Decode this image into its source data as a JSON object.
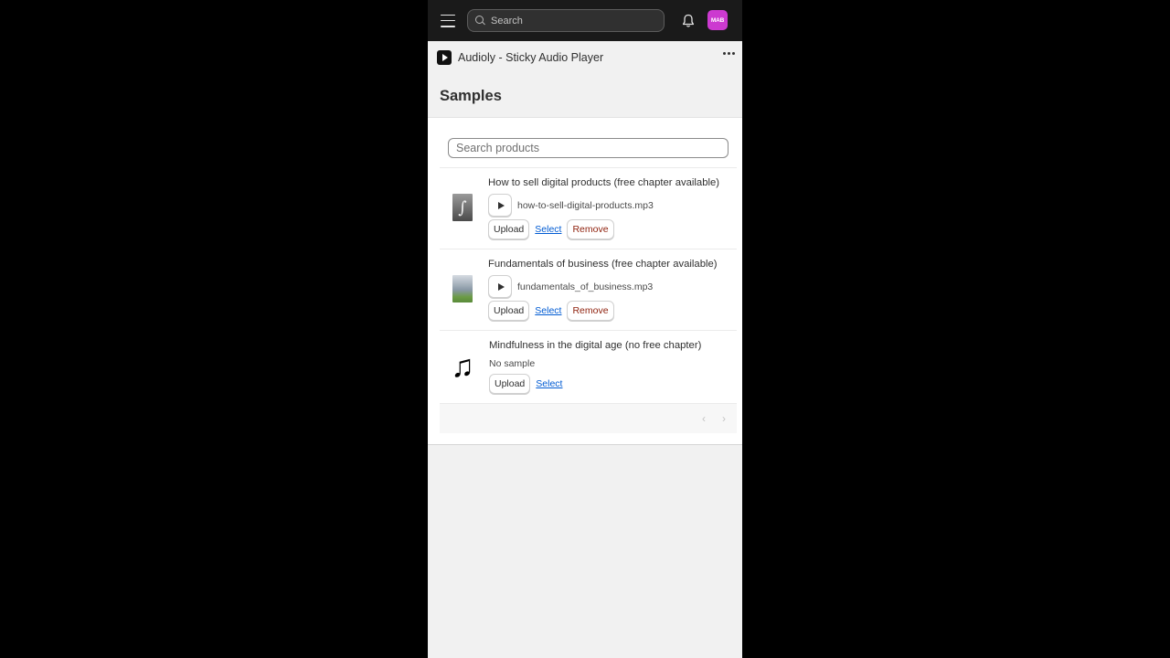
{
  "topbar": {
    "search_placeholder": "Search",
    "avatar_initials": "MAB",
    "colors": {
      "bar": "#1a1a1a",
      "avatar": "#cc3ad0"
    }
  },
  "app": {
    "title": "Audioly - Sticky Audio Player",
    "page_title": "Samples"
  },
  "samples": {
    "search_placeholder": "Search products",
    "products": [
      {
        "title": "How to sell digital products (free chapter available)",
        "thumbnail": "book-cover-image",
        "file": "how-to-sell-digital-products.mp3",
        "actions": {
          "upload": "Upload",
          "select": "Select",
          "remove": "Remove"
        }
      },
      {
        "title": "Fundamentals of business (free chapter available)",
        "thumbnail": "building-image",
        "file": "fundamentals_of_business.mp3",
        "actions": {
          "upload": "Upload",
          "select": "Select",
          "remove": "Remove"
        }
      },
      {
        "title": "Mindfulness in the digital age (no free chapter)",
        "thumbnail": "music-note-icon",
        "status": "No sample",
        "actions": {
          "upload": "Upload",
          "select": "Select"
        }
      }
    ],
    "pagination": {
      "prev": "‹",
      "next": "›"
    }
  },
  "icons": {
    "note_glyph": "♫",
    "book_glyph": "∫"
  }
}
